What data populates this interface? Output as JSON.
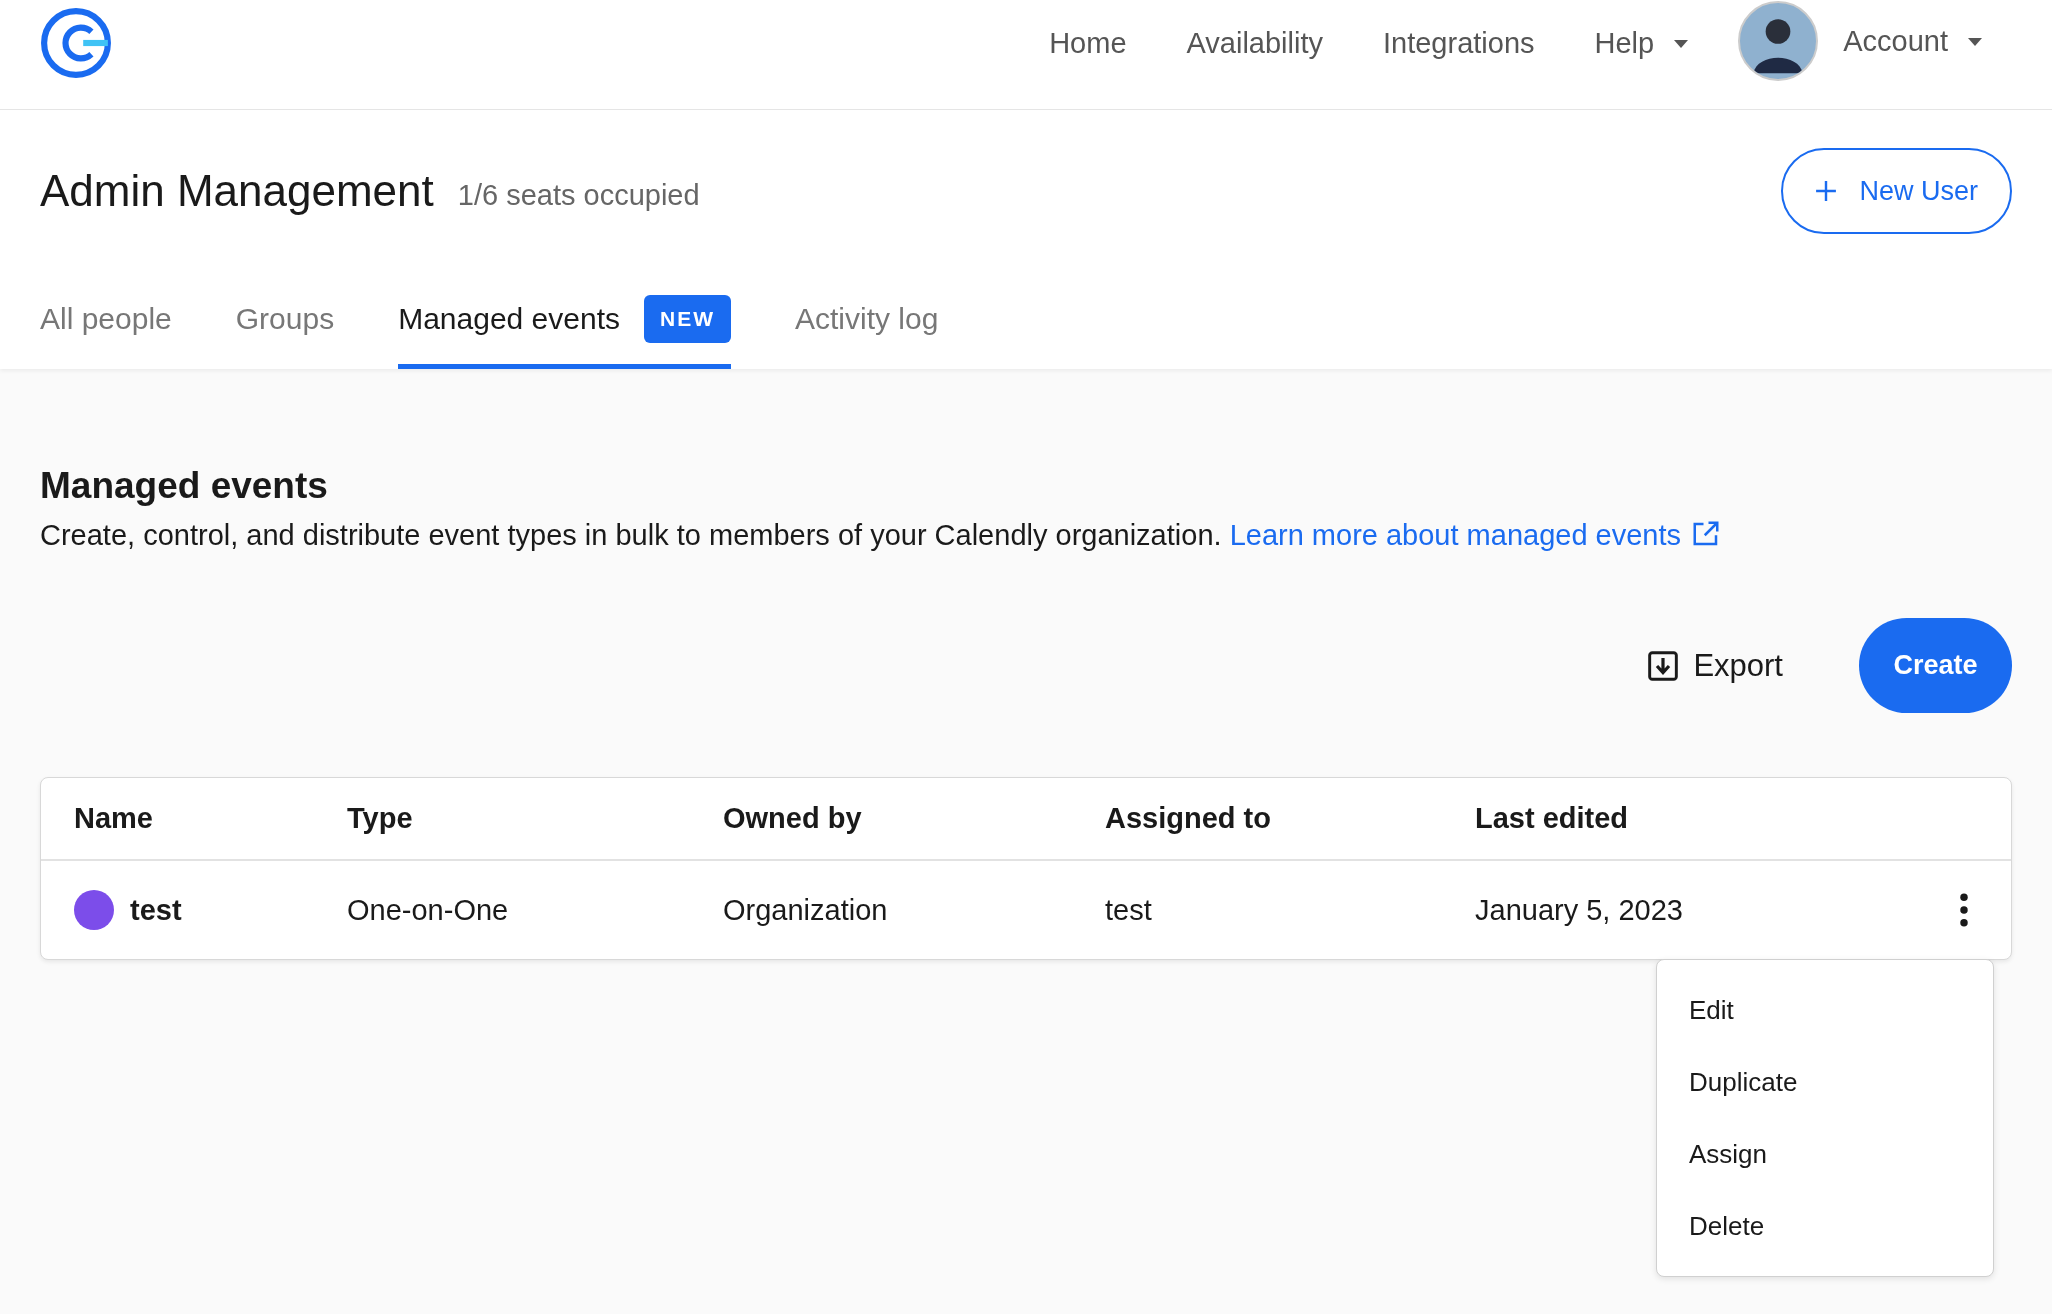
{
  "nav": {
    "items": [
      {
        "label": "Home",
        "dropdown": false
      },
      {
        "label": "Availability",
        "dropdown": false
      },
      {
        "label": "Integrations",
        "dropdown": false
      },
      {
        "label": "Help",
        "dropdown": true
      }
    ],
    "account": {
      "label": "Account",
      "dropdown": true
    }
  },
  "page": {
    "title": "Admin Management",
    "seats": "1/6 seats occupied",
    "new_user_button": "New User"
  },
  "tabs": [
    {
      "label": "All people",
      "selected": false
    },
    {
      "label": "Groups",
      "selected": false
    },
    {
      "label": "Managed events",
      "selected": true,
      "badge": "NEW"
    },
    {
      "label": "Activity log",
      "selected": false
    }
  ],
  "section": {
    "heading": "Managed events",
    "description": "Create, control, and distribute event types in bulk to members of your Calendly organization.",
    "link": "Learn more about managed events"
  },
  "actions": {
    "export": "Export",
    "create": "Create"
  },
  "table": {
    "columns": [
      "Name",
      "Type",
      "Owned by",
      "Assigned to",
      "Last edited"
    ],
    "rows": [
      {
        "name": "test",
        "color": "#7c4dea",
        "type": "One-on-One",
        "owned_by": "Organization",
        "assigned_to": "test",
        "last_edited": "January 5, 2023",
        "menu_open": true
      }
    ]
  },
  "menu": {
    "items": [
      "Edit",
      "Duplicate",
      "Assign",
      "Delete"
    ]
  }
}
